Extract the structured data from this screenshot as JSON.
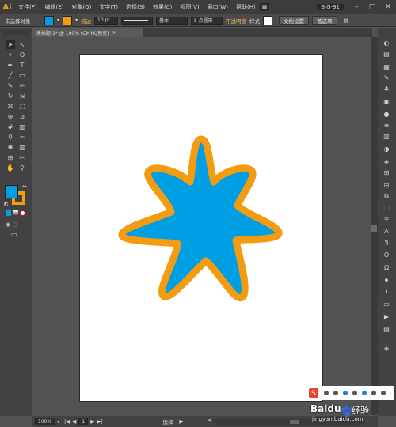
{
  "app": {
    "logo_text": "Ai"
  },
  "menubar": {
    "items": [
      "文件(F)",
      "编辑(E)",
      "对象(O)",
      "文字(T)",
      "选择(S)",
      "效果(C)",
      "视图(V)",
      "窗口(W)",
      "帮助(H)"
    ],
    "workspace_label": "BIG-91"
  },
  "controlbar": {
    "selection_label": "未选择对象",
    "stroke_label": "描边",
    "stroke_value": "10 pt",
    "brush_label": "基本",
    "point_label": "5 点圆形",
    "opacity_label": "不透明度",
    "style_label": "样式",
    "doc_setup_label": "文档设置",
    "preferences_label": "首选项"
  },
  "document": {
    "tab_title": "未标题-1* @ 100% (CMYK/预览)",
    "close_glyph": "×"
  },
  "statusbar": {
    "zoom": "100%",
    "page": "1",
    "tool": "选择"
  },
  "colors": {
    "fill": "#009fe3",
    "stroke": "#f39c12",
    "artboard": "#ffffff",
    "pasteboard": "#535353"
  },
  "icons": {
    "left_tools": [
      "selection-tool-icon",
      "direct-selection-tool-icon",
      "magic-wand-tool-icon",
      "lasso-tool-icon",
      "pen-tool-icon",
      "type-tool-icon",
      "line-tool-icon",
      "rectangle-tool-icon",
      "paintbrush-tool-icon",
      "pencil-tool-icon",
      "rotate-tool-icon",
      "scale-tool-icon",
      "width-tool-icon",
      "free-transform-tool-icon",
      "shape-builder-tool-icon",
      "perspective-grid-tool-icon",
      "mesh-tool-icon",
      "gradient-tool-icon",
      "eyedropper-tool-icon",
      "blend-tool-icon",
      "symbol-sprayer-tool-icon",
      "column-graph-tool-icon",
      "artboard-tool-icon",
      "slice-tool-icon",
      "hand-tool-icon",
      "zoom-tool-icon"
    ],
    "right_panels": [
      "color-panel-icon",
      "color-guide-panel-icon",
      "swatches-panel-icon",
      "brushes-panel-icon",
      "symbols-panel-icon",
      "graphic-styles-panel-icon",
      "appearance-panel-icon",
      "stroke-panel-icon",
      "gradient-panel-icon",
      "transparency-panel-icon",
      "layers-panel-icon",
      "artboards-panel-icon",
      "align-panel-icon",
      "pathfinder-panel-icon",
      "transform-panel-icon",
      "links-panel-icon",
      "type-panel-icon",
      "paragraph-panel-icon",
      "opentype-panel-icon",
      "glyphs-panel-icon",
      "navigator-panel-icon",
      "info-panel-icon",
      "document-info-panel-icon",
      "actions-panel-icon",
      "attributes-panel-icon"
    ]
  },
  "watermark": {
    "brand": "Baidu",
    "site_label": "经验",
    "url": "jingyan.baidu.com"
  }
}
